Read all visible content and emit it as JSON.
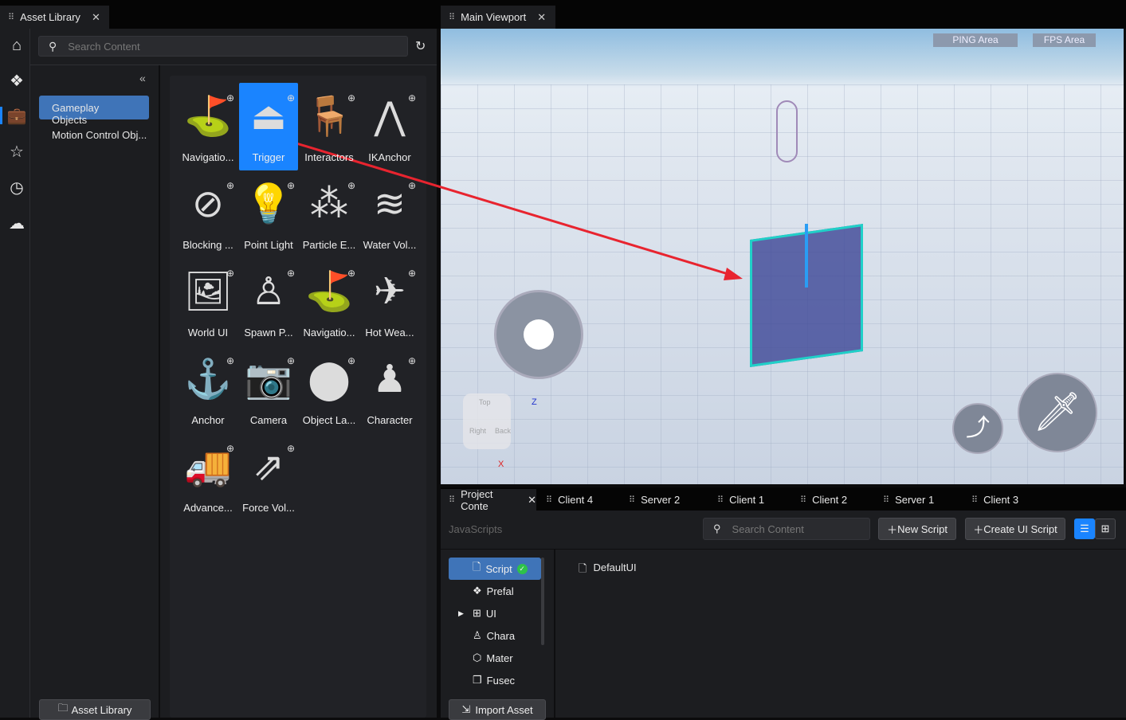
{
  "asset_library": {
    "tab_label": "Asset Library",
    "search_placeholder": "Search Content",
    "categories": [
      {
        "label": "Gameplay Objects",
        "selected": true
      },
      {
        "label": "Motion Control Obj..."
      }
    ],
    "items": [
      {
        "label": "Navigatio...",
        "icon": "signpost-icon",
        "glyph": "⛳"
      },
      {
        "label": "Trigger",
        "icon": "trigger-icon",
        "glyph": "⏏",
        "selected": true
      },
      {
        "label": "Interactors",
        "icon": "chair-icon",
        "glyph": "🪑"
      },
      {
        "label": "IKAnchor",
        "icon": "ik-anchor-icon",
        "glyph": "⋀"
      },
      {
        "label": "Blocking ...",
        "icon": "blocking-icon",
        "glyph": "⊘"
      },
      {
        "label": "Point Light",
        "icon": "lightbulb-icon",
        "glyph": "💡"
      },
      {
        "label": "Particle E...",
        "icon": "particle-icon",
        "glyph": "⁂"
      },
      {
        "label": "Water Vol...",
        "icon": "water-icon",
        "glyph": "≋"
      },
      {
        "label": "World UI",
        "icon": "image-icon",
        "glyph": "🖼"
      },
      {
        "label": "Spawn P...",
        "icon": "spawn-icon",
        "glyph": "♙"
      },
      {
        "label": "Navigatio...",
        "icon": "signpost-icon",
        "glyph": "⛳"
      },
      {
        "label": "Hot Wea...",
        "icon": "weapon-icon",
        "glyph": "✈"
      },
      {
        "label": "Anchor",
        "icon": "anchor-icon",
        "glyph": "⚓"
      },
      {
        "label": "Camera",
        "icon": "camera-icon",
        "glyph": "📷"
      },
      {
        "label": "Object La...",
        "icon": "launcher-icon",
        "glyph": "⬤"
      },
      {
        "label": "Character",
        "icon": "character-icon",
        "glyph": "♟"
      },
      {
        "label": "Advance...",
        "icon": "truck-icon",
        "glyph": "🚚"
      },
      {
        "label": "Force Vol...",
        "icon": "force-icon",
        "glyph": "⇗"
      }
    ],
    "bottom_button": "Asset Library"
  },
  "viewport": {
    "tab_label": "Main Viewport",
    "ping_label": "PING Area",
    "fps_label": "FPS Area",
    "gizmo_labels": {
      "top": "Top",
      "right": "Right",
      "back": "Back",
      "z": "Z",
      "x": "X"
    }
  },
  "bottom_panel": {
    "tabs": [
      "Project Conte",
      "Client 4",
      "Server 2",
      "Client 1",
      "Client 2",
      "Server 1",
      "Client 3"
    ],
    "breadcrumb": "JavaScripts",
    "search_placeholder": "Search Content",
    "new_script": "New Script",
    "create_ui_script": "Create UI Script",
    "tree": [
      {
        "label": "Script",
        "icon": "file-icon",
        "selected": true
      },
      {
        "label": "Prefal",
        "icon": "prefab-icon"
      },
      {
        "label": "UI",
        "icon": "ui-icon"
      },
      {
        "label": "Chara",
        "icon": "character-icon"
      },
      {
        "label": "Mater",
        "icon": "material-icon"
      },
      {
        "label": "Fusec",
        "icon": "fused-icon"
      }
    ],
    "files": [
      {
        "label": "DefaultUI"
      }
    ],
    "import_asset": "Import Asset"
  },
  "colors": {
    "accent": "#1a84ff",
    "selected_category": "#3f74b8",
    "annotation_arrow": "#e8242f"
  }
}
